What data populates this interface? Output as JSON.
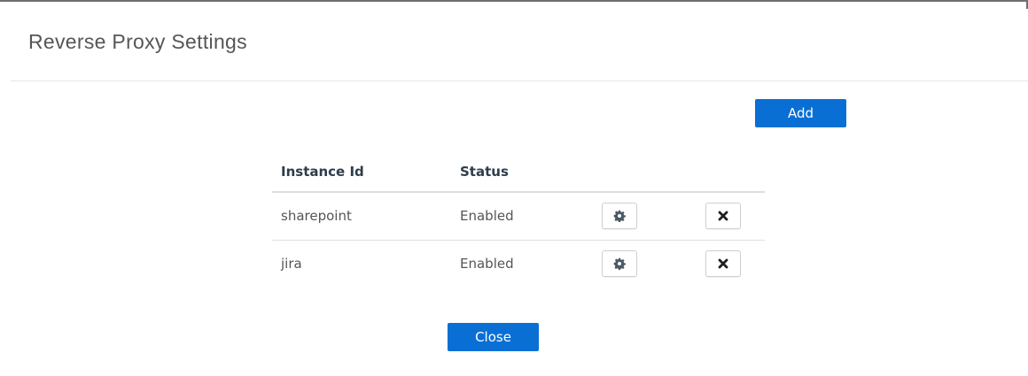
{
  "dialog": {
    "title": "Reverse Proxy Settings",
    "add_label": "Add",
    "close_label": "Close"
  },
  "table": {
    "headers": [
      "Instance Id",
      "Status"
    ],
    "rows": [
      {
        "instance_id": "sharepoint",
        "status": "Enabled",
        "settings_icon": "gear-icon",
        "delete_icon": "close-icon"
      },
      {
        "instance_id": "jira",
        "status": "Enabled",
        "settings_icon": "gear-icon",
        "delete_icon": "close-icon"
      }
    ]
  },
  "colors": {
    "primary": "#0a6fd4",
    "header_text": "#2d3d4b",
    "body_text": "#555555"
  }
}
